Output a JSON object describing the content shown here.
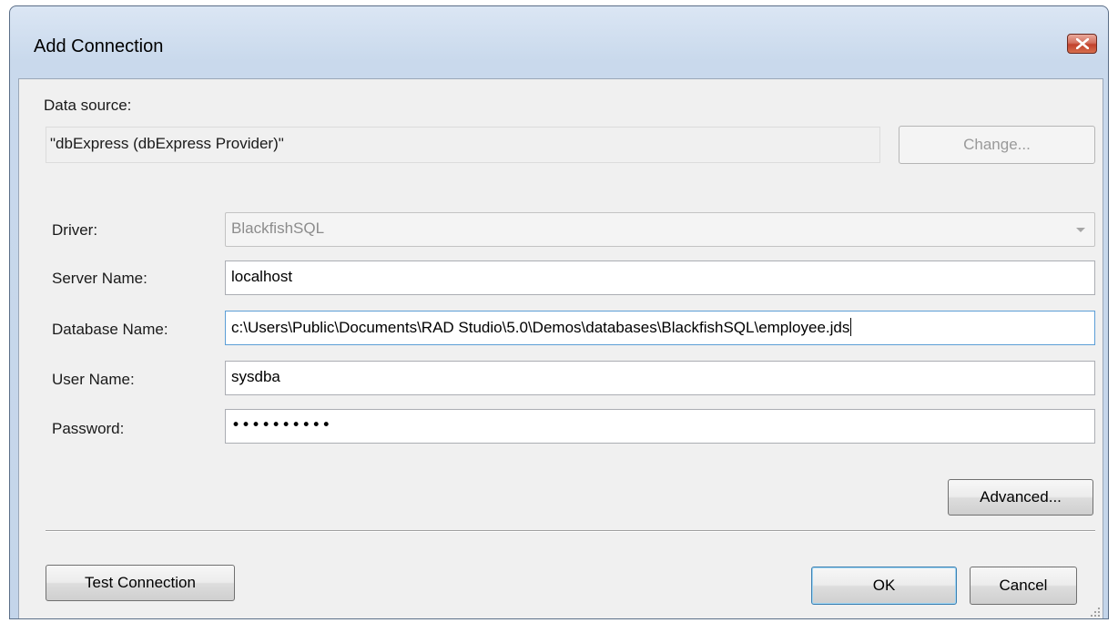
{
  "window": {
    "title": "Add Connection"
  },
  "data_source": {
    "label": "Data source:",
    "value": "\"dbExpress (dbExpress Provider)\"",
    "change_button": "Change..."
  },
  "fields": {
    "driver": {
      "label": "Driver:",
      "value": "BlackfishSQL"
    },
    "server_name": {
      "label": "Server Name:",
      "value": "localhost"
    },
    "database_name": {
      "label": "Database Name:",
      "value": "c:\\Users\\Public\\Documents\\RAD Studio\\5.0\\Demos\\databases\\BlackfishSQL\\employee.jds"
    },
    "user_name": {
      "label": "User Name:",
      "value": "sysdba"
    },
    "password": {
      "label": "Password:",
      "value": "••••••••••"
    }
  },
  "buttons": {
    "advanced": "Advanced...",
    "test_connection": "Test Connection",
    "ok": "OK",
    "cancel": "Cancel"
  },
  "icons": {
    "close": "close-icon",
    "dropdown": "chevron-down-icon",
    "resize": "resize-grip-icon"
  },
  "colors": {
    "title_gradient_top": "#dbe6f4",
    "close_button": "#c2412c",
    "client_background": "#f0f0f0"
  }
}
